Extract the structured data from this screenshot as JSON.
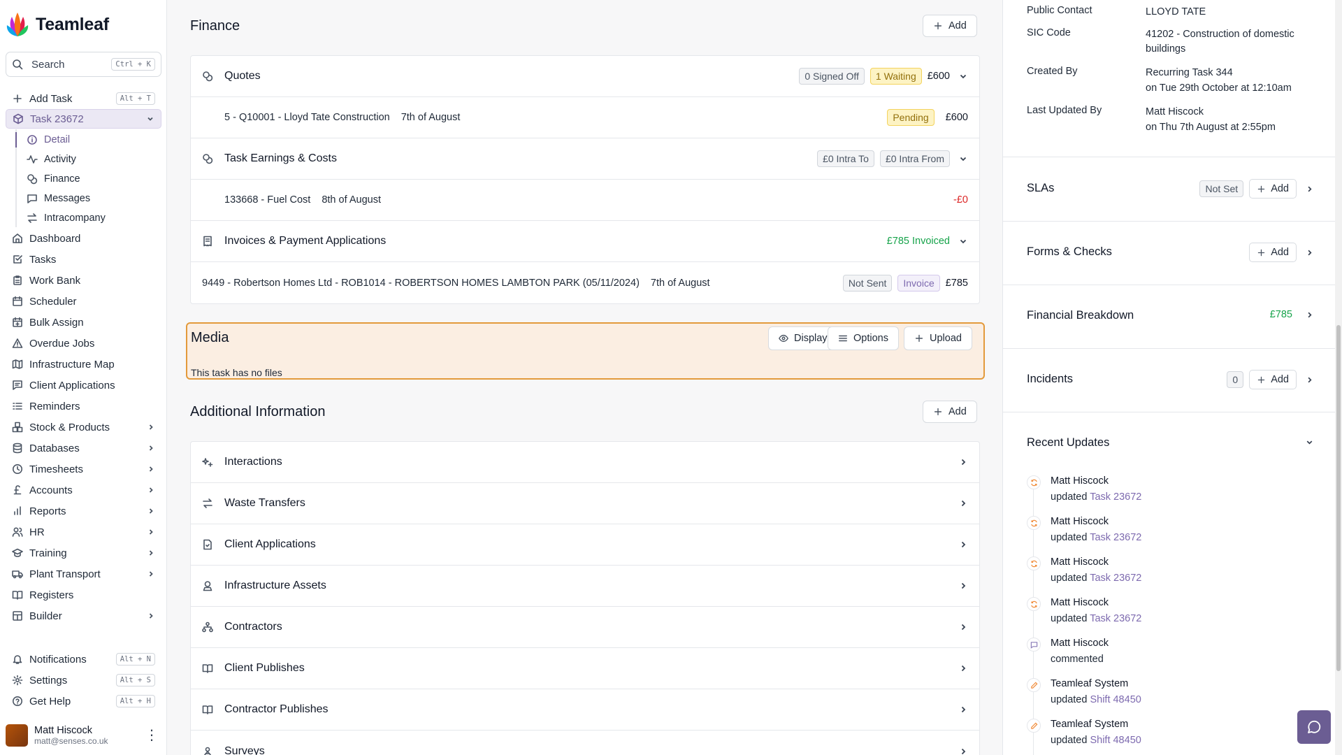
{
  "app": {
    "name": "Teamleaf"
  },
  "search": {
    "placeholder": "Search",
    "shortcut": "Ctrl + K"
  },
  "sidebar": {
    "add_task": {
      "label": "Add Task",
      "shortcut": "Alt + T"
    },
    "task": {
      "label": "Task 23672"
    },
    "sub_items": [
      {
        "label": "Detail",
        "icon": "info-icon"
      },
      {
        "label": "Activity",
        "icon": "activity-icon"
      },
      {
        "label": "Finance",
        "icon": "coins-icon"
      },
      {
        "label": "Messages",
        "icon": "message-icon"
      },
      {
        "label": "Intracompany",
        "icon": "transfer-icon"
      }
    ],
    "items": [
      {
        "label": "Dashboard",
        "icon": "home-icon",
        "expand": false
      },
      {
        "label": "Tasks",
        "icon": "check-square-icon",
        "expand": false
      },
      {
        "label": "Work Bank",
        "icon": "clipboard-icon",
        "expand": false
      },
      {
        "label": "Scheduler",
        "icon": "calendar-icon",
        "expand": false
      },
      {
        "label": "Bulk Assign",
        "icon": "calendar-plus-icon",
        "expand": false
      },
      {
        "label": "Overdue Jobs",
        "icon": "warning-icon",
        "expand": false
      },
      {
        "label": "Infrastructure Map",
        "icon": "map-icon",
        "expand": false
      },
      {
        "label": "Client Applications",
        "icon": "file-text-icon",
        "expand": false
      },
      {
        "label": "Reminders",
        "icon": "list-icon",
        "expand": false
      },
      {
        "label": "Stock & Products",
        "icon": "boxes-icon",
        "expand": true
      },
      {
        "label": "Databases",
        "icon": "database-icon",
        "expand": true
      },
      {
        "label": "Timesheets",
        "icon": "clock-icon",
        "expand": true
      },
      {
        "label": "Accounts",
        "icon": "pound-icon",
        "expand": true
      },
      {
        "label": "Reports",
        "icon": "bar-chart-icon",
        "expand": true
      },
      {
        "label": "HR",
        "icon": "users-icon",
        "expand": true
      },
      {
        "label": "Training",
        "icon": "graduation-cap-icon",
        "expand": true
      },
      {
        "label": "Plant Transport",
        "icon": "truck-icon",
        "expand": true
      },
      {
        "label": "Registers",
        "icon": "book-open-icon",
        "expand": false
      },
      {
        "label": "Builder",
        "icon": "layout-icon",
        "expand": true
      }
    ],
    "footer": [
      {
        "label": "Notifications",
        "icon": "bell-icon",
        "shortcut": "Alt + N"
      },
      {
        "label": "Settings",
        "icon": "gear-icon",
        "shortcut": "Alt + S"
      },
      {
        "label": "Get Help",
        "icon": "help-circle-icon",
        "shortcut": "Alt + H"
      }
    ],
    "user": {
      "name": "Matt Hiscock",
      "email": "matt@senses.co.uk"
    }
  },
  "finance": {
    "title": "Finance",
    "add_label": "Add",
    "quotes": {
      "title": "Quotes",
      "badges": [
        "0 Signed Off",
        "1 Waiting"
      ],
      "amount": "£600",
      "items": [
        {
          "name": "5 - Q10001 - Lloyd Tate Construction",
          "date": "7th of August",
          "status": "Pending",
          "amount": "£600"
        }
      ]
    },
    "earnings": {
      "title": "Task Earnings & Costs",
      "badges": [
        "£0 Intra To",
        "£0 Intra From"
      ],
      "items": [
        {
          "name": "133668 - Fuel Cost",
          "date": "8th of August",
          "amount": "-£0"
        }
      ]
    },
    "invoices": {
      "title": "Invoices & Payment Applications",
      "summary": "£785 Invoiced",
      "items": [
        {
          "name": "9449 - Robertson Homes Ltd - ROB1014 - ROBERTSON HOMES LAMBTON PARK (05/11/2024)",
          "date": "7th of August",
          "status": "Not Sent",
          "type": "Invoice",
          "amount": "£785"
        }
      ]
    }
  },
  "media": {
    "title": "Media",
    "display_label": "Display",
    "options_label": "Options",
    "upload_label": "Upload",
    "empty_text": "This task has no files"
  },
  "additional": {
    "title": "Additional Information",
    "add_label": "Add",
    "items": [
      {
        "label": "Interactions",
        "icon": "sparkle-icon"
      },
      {
        "label": "Waste Transfers",
        "icon": "transfer-icon"
      },
      {
        "label": "Client Applications",
        "icon": "file-icon"
      },
      {
        "label": "Infrastructure Assets",
        "icon": "asset-icon"
      },
      {
        "label": "Contractors",
        "icon": "network-icon"
      },
      {
        "label": "Client Publishes",
        "icon": "book-icon"
      },
      {
        "label": "Contractor Publishes",
        "icon": "book-icon"
      },
      {
        "label": "Surveys",
        "icon": "survey-icon"
      }
    ]
  },
  "details": {
    "public_contact": {
      "label": "Public Contact",
      "value": "LLOYD TATE"
    },
    "sic_code": {
      "label": "SIC Code",
      "value_1": "41202 - Construction of domestic",
      "value_2": "buildings"
    },
    "created_by": {
      "label": "Created By",
      "value_1": "Recurring Task 344",
      "value_2": "on Tue 29th October at 12:10am"
    },
    "last_updated_by": {
      "label": "Last Updated By",
      "value_1": "Matt Hiscock",
      "value_2": "on Thu 7th August at 2:55pm"
    }
  },
  "sections": {
    "slas": {
      "title": "SLAs",
      "status": "Not Set",
      "add_label": "Add"
    },
    "forms": {
      "title": "Forms & Checks",
      "add_label": "Add"
    },
    "financial_breakdown": {
      "title": "Financial Breakdown",
      "amount": "£785"
    },
    "incidents": {
      "title": "Incidents",
      "count": "0",
      "add_label": "Add"
    },
    "recent_updates": {
      "title": "Recent Updates"
    }
  },
  "updates": [
    {
      "who": "Matt Hiscock",
      "action": "updated",
      "target": "Task 23672",
      "icon": "refresh-icon"
    },
    {
      "who": "Matt Hiscock",
      "action": "updated",
      "target": "Task 23672",
      "icon": "refresh-icon"
    },
    {
      "who": "Matt Hiscock",
      "action": "updated",
      "target": "Task 23672",
      "icon": "refresh-icon"
    },
    {
      "who": "Matt Hiscock",
      "action": "updated",
      "target": "Task 23672",
      "icon": "refresh-icon"
    },
    {
      "who": "Matt Hiscock",
      "action": "commented",
      "target": "",
      "icon": "comment-icon"
    },
    {
      "who": "Teamleaf System",
      "action": "updated",
      "target": "Shift 48450",
      "icon": "pencil-icon"
    },
    {
      "who": "Teamleaf System",
      "action": "updated",
      "target": "Shift 48450",
      "icon": "pencil-icon"
    }
  ],
  "colors": {
    "accent": "#6b5d93",
    "media_border": "#e39a3b",
    "media_bg": "#fbeee2",
    "positive": "#16a34a",
    "negative": "#dc2626"
  }
}
